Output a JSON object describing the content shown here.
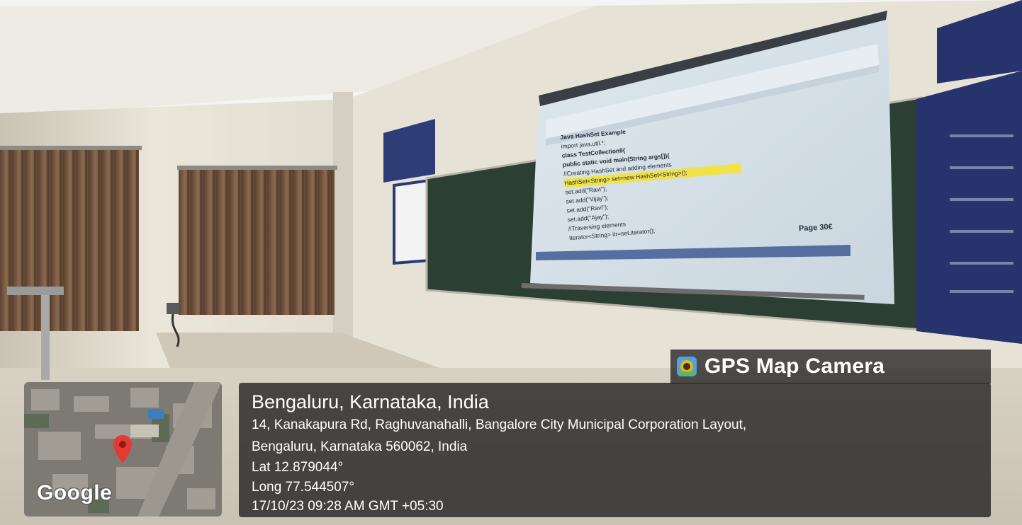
{
  "stamp": {
    "app_name": "GPS Map Camera",
    "map_logo": "Google",
    "title": "Bengaluru, Karnataka, India",
    "address_line1": "14, Kanakapura Rd, Raghuvanahalli, Bangalore City Municipal Corporation Layout,",
    "address_line2": "Bengaluru, Karnataka 560062, India",
    "latitude": "Lat 12.879044°",
    "longitude": "Long 77.544507°",
    "datetime": "17/10/23 09:28 AM GMT +05:30",
    "pin_icon": "map-pin-icon",
    "app_icon": "camera-lens-icon"
  },
  "screen": {
    "code_lines": [
      "Java HashSet Example",
      "import java.util.*;",
      "class TestCollection9{",
      "public static void main(String args[]){",
      "//Creating HashSet and adding elements",
      "HashSet<String> set=new HashSet<String>();",
      "set.add(\"Ravi\");",
      "set.add(\"Vijay\");",
      "set.add(\"Ravi\");",
      "set.add(\"Ajay\");",
      "//Traversing elements",
      "Iterator<String> itr=set.iterator();"
    ],
    "page_label": "Page 30€"
  },
  "colors": {
    "wall": "#e9e4d8",
    "floor": "#d9d2c4",
    "curtain": "#7a5b44",
    "chalkboard": "#2f4436",
    "overlay": "#141414",
    "pin": "#e53935"
  }
}
